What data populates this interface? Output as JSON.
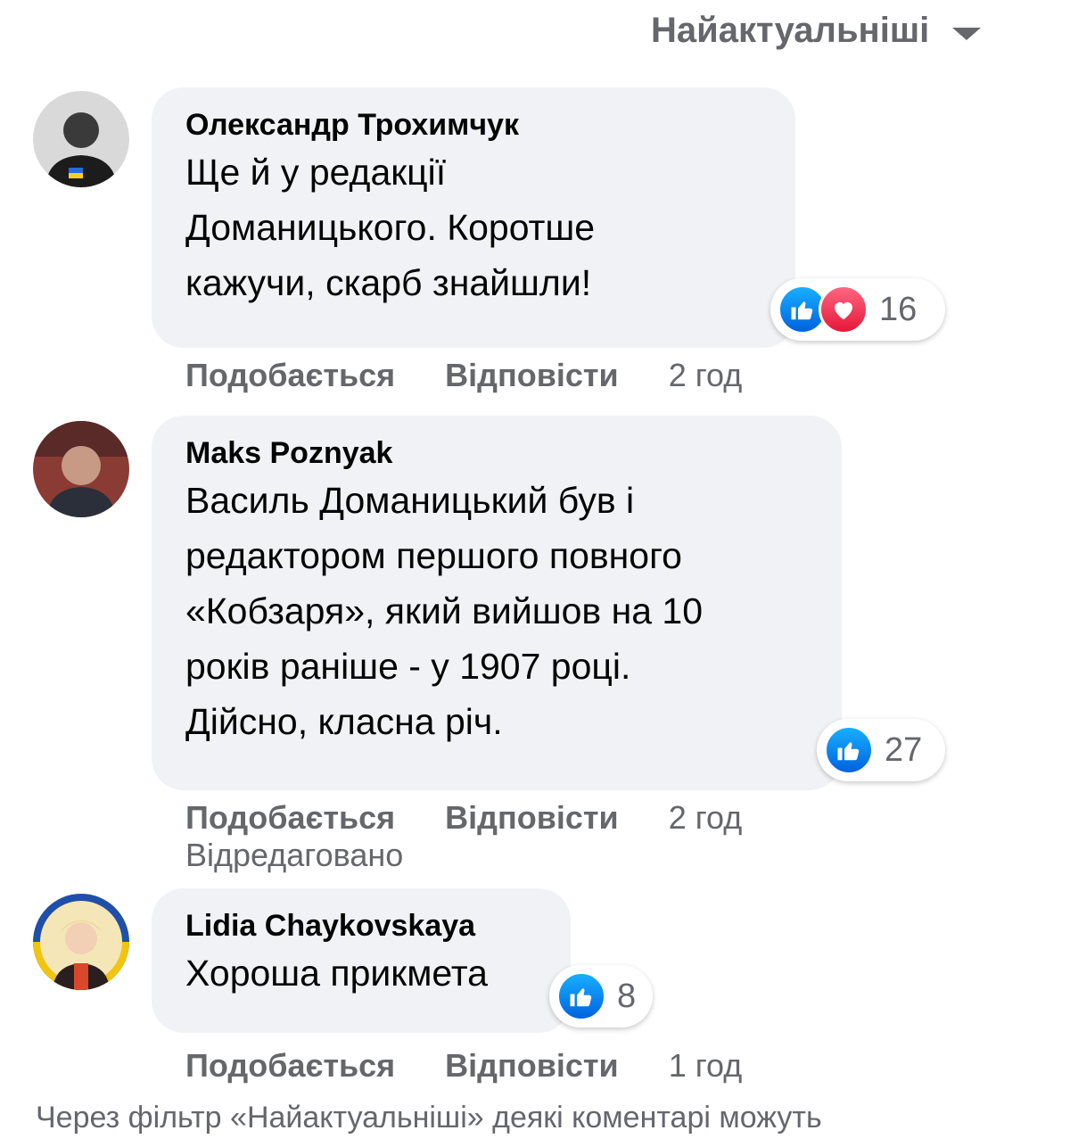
{
  "sort": {
    "label": "Найактуальніші"
  },
  "comments": [
    {
      "author": "Олександр Трохимчук",
      "text": "Ще й у редакції\nДоманицького. Коротше\nкажучи, скарб знайшли!",
      "reaction_count": "16",
      "reactions": [
        "like-icon",
        "love-icon"
      ],
      "like_label": "Подобається",
      "reply_label": "Відповісти",
      "time": "2 год"
    },
    {
      "author": "Maks Poznyak",
      "text": "Василь Доманицький був і\nредактором першого повного\n«Кобзаря», який вийшов на 10\nроків раніше - у 1907 році.\nДійсно, класна річ.",
      "reaction_count": "27",
      "reactions": [
        "like-icon"
      ],
      "like_label": "Подобається",
      "reply_label": "Відповісти",
      "time": "2 год",
      "edited_label": "Відредаговано"
    },
    {
      "author": "Lidia Chaykovskaya",
      "text": "Хороша прикмета",
      "reaction_count": "8",
      "reactions": [
        "like-icon"
      ],
      "like_label": "Подобається",
      "reply_label": "Відповісти",
      "time": "1 год"
    }
  ],
  "footer": {
    "text": "Через фільтр «Найактуальніші» деякі коментарі можуть"
  },
  "colors": {
    "like_blue": "#1877f2",
    "love_red": "#f33e58",
    "bubble_bg": "#f0f2f5",
    "secondary_text": "#65676b"
  }
}
